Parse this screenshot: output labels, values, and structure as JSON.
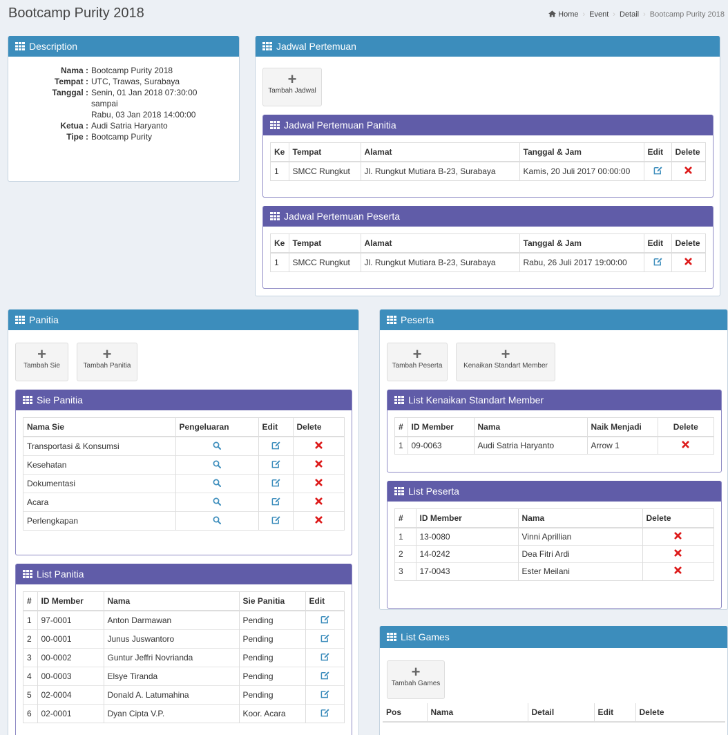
{
  "page_title": "Bootcamp Purity 2018",
  "breadcrumb": [
    "Home",
    "Event",
    "Detail",
    "Bootcamp Purity 2018"
  ],
  "description": {
    "title": "Description",
    "rows": [
      {
        "k": "Nama :",
        "v": "Bootcamp Purity 2018"
      },
      {
        "k": "Tempat :",
        "v": "UTC, Trawas, Surabaya"
      },
      {
        "k": "Tanggal :",
        "v": "Senin, 01 Jan 2018 07:30:00"
      },
      {
        "k": "",
        "v": "sampai"
      },
      {
        "k": "",
        "v": "Rabu, 03 Jan 2018 14:00:00"
      },
      {
        "k": "Ketua :",
        "v": "Audi Satria Haryanto"
      },
      {
        "k": "Tipe :",
        "v": "Bootcamp Purity"
      }
    ]
  },
  "jadwal": {
    "title": "Jadwal Pertemuan",
    "add_label": "Tambah Jadwal",
    "headers": [
      "Ke",
      "Tempat",
      "Alamat",
      "Tanggal & Jam",
      "Edit",
      "Delete"
    ],
    "panitia": {
      "title": "Jadwal Pertemuan Panitia",
      "rows": [
        [
          "1",
          "SMCC Rungkut",
          "Jl. Rungkut Mutiara B-23, Surabaya",
          "Kamis, 20 Juli 2017 00:00:00"
        ]
      ]
    },
    "peserta": {
      "title": "Jadwal Pertemuan Peserta",
      "rows": [
        [
          "1",
          "SMCC Rungkut",
          "Jl. Rungkut Mutiara B-23, Surabaya",
          "Rabu, 26 Juli 2017 19:00:00"
        ]
      ]
    }
  },
  "panitia": {
    "title": "Panitia",
    "add_sie_label": "Tambah Sie",
    "add_panitia_label": "Tambah Panitia",
    "sie": {
      "title": "Sie Panitia",
      "headers": [
        "Nama Sie",
        "Pengeluaran",
        "Edit",
        "Delete"
      ],
      "rows": [
        "Transportasi & Konsumsi",
        "Kesehatan",
        "Dokumentasi",
        "Acara",
        "Perlengkapan"
      ]
    },
    "list": {
      "title": "List Panitia",
      "headers": [
        "#",
        "ID Member",
        "Nama",
        "Sie Panitia",
        "Edit"
      ],
      "rows": [
        [
          "1",
          "97-0001",
          "Anton Darmawan",
          "Pending"
        ],
        [
          "2",
          "00-0001",
          "Junus Juswantoro",
          "Pending"
        ],
        [
          "3",
          "00-0002",
          "Guntur Jeffri Novrianda",
          "Pending"
        ],
        [
          "4",
          "00-0003",
          "Elsye Tiranda",
          "Pending"
        ],
        [
          "5",
          "02-0004",
          "Donald A. Latumahina",
          "Pending"
        ],
        [
          "6",
          "02-0001",
          "Dyan Cipta V.P.",
          "Koor. Acara"
        ]
      ]
    }
  },
  "peserta": {
    "title": "Peserta",
    "add_peserta_label": "Tambah Peserta",
    "kenaikan_label": "Kenaikan Standart Member",
    "kenaikan": {
      "title": "List Kenaikan Standart Member",
      "headers": [
        "#",
        "ID Member",
        "Nama",
        "Naik Menjadi",
        "Delete"
      ],
      "rows": [
        [
          "1",
          "09-0063",
          "Audi Satria Haryanto",
          "Arrow 1"
        ]
      ]
    },
    "list": {
      "title": "List Peserta",
      "headers": [
        "#",
        "ID Member",
        "Nama",
        "Delete"
      ],
      "rows": [
        [
          "1",
          "13-0080",
          "Vinni Aprillian"
        ],
        [
          "2",
          "14-0242",
          "Dea Fitri Ardi"
        ],
        [
          "3",
          "17-0043",
          "Ester Meilani"
        ]
      ]
    }
  },
  "games": {
    "title": "List Games",
    "add_label": "Tambah Games",
    "headers": [
      "Pos",
      "Nama",
      "Detail",
      "Edit",
      "Delete"
    ]
  }
}
